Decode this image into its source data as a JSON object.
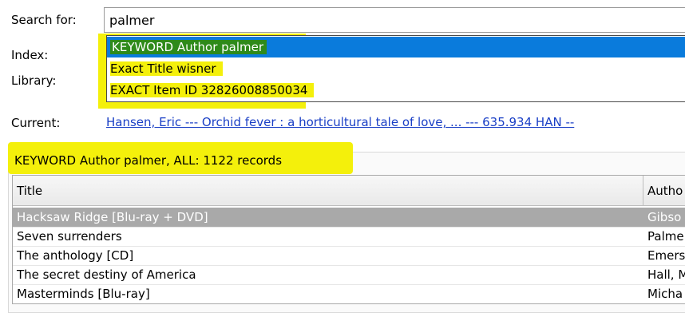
{
  "search": {
    "label": "Search for:",
    "value": "palmer"
  },
  "index": {
    "label": "Index:"
  },
  "library": {
    "label": "Library:"
  },
  "suggestions": [
    {
      "text": "KEYWORD Author palmer",
      "selected": true
    },
    {
      "text": "Exact Title wisner",
      "selected": false
    },
    {
      "text": "EXACT Item ID 32826008850034",
      "selected": false
    }
  ],
  "current": {
    "label": "Current:",
    "link": "Hansen, Eric --- Orchid fever : a horticultural tale of love, ... --- 635.934 HAN --"
  },
  "results": {
    "summary": "KEYWORD Author palmer, ALL: 1122 records",
    "columns": [
      "Title",
      "Autho"
    ],
    "rows": [
      {
        "title": "Hacksaw Ridge [Blu-ray + DVD]",
        "author": "Gibso",
        "selected": true
      },
      {
        "title": "Seven surrenders",
        "author": "Palme",
        "selected": false
      },
      {
        "title": "The anthology [CD]",
        "author": "Emers",
        "selected": false
      },
      {
        "title": "The secret destiny of America",
        "author": "Hall, M",
        "selected": false
      },
      {
        "title": "Masterminds [Blu-ray]",
        "author": "Micha",
        "selected": false
      }
    ]
  },
  "colors": {
    "highlight": "#f4f00b",
    "selection_blue": "#0a7bdc",
    "selection_green": "#2e8a1a",
    "link": "#1a3fc6",
    "row_selected": "#a9a9a9"
  }
}
